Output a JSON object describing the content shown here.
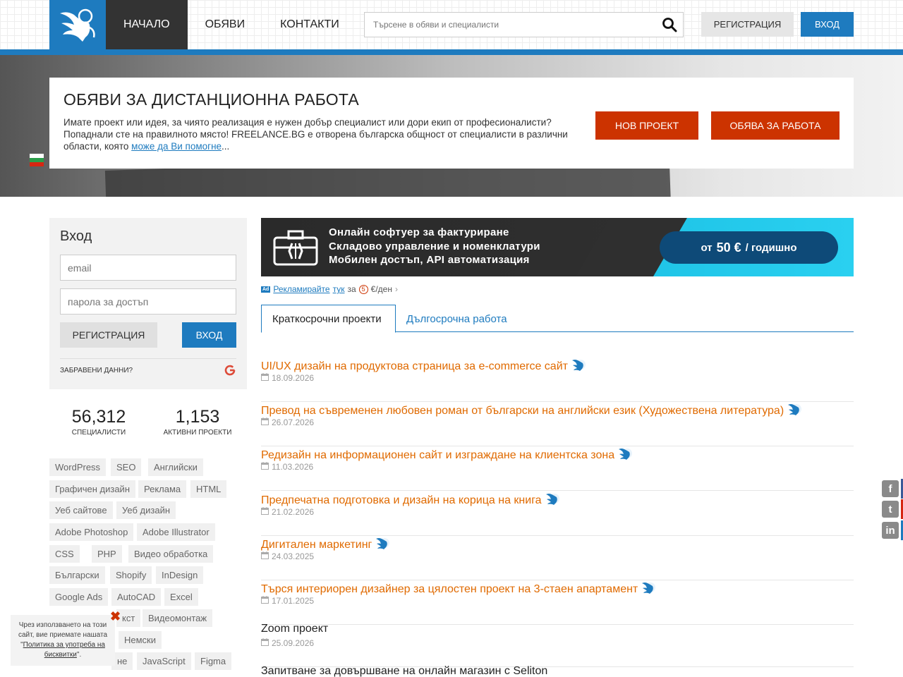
{
  "nav": {
    "items": [
      "Начало",
      "Обяви",
      "Контакти"
    ],
    "search_placeholder": "Търсене в обяви и специалисти",
    "register": "Регистрация",
    "login": "Вход"
  },
  "hero": {
    "title": "Обяви за дистанционна работа",
    "text_1": "Имате проект или идея, за чиято реализация е нужен добър специалист или дори екип от професионалисти? Попаднали сте на правилното място! FREELANCE.BG е отворена българска общност от специалисти в различни области, която ",
    "link": "може да Ви помогне",
    "text_2": "...",
    "btn_new": "Нов проект",
    "btn_job": "Обява за работа"
  },
  "login": {
    "title": "Вход",
    "email_placeholder": "email",
    "password_placeholder": "парола за достъп",
    "register": "Регистрация",
    "login": "Вход",
    "forgot": "Забравени данни?"
  },
  "stats": [
    {
      "num": "56,312",
      "label": "Специалисти"
    },
    {
      "num": "1,153",
      "label": "Активни проекти"
    }
  ],
  "tags": [
    "WordPress",
    "SEO",
    "Английски",
    "Графичен дизайн",
    "Реклама",
    "HTML",
    "Уеб сайтове",
    "Уеб дизайн",
    "Adobe Photoshop",
    "Adobe Illustrator",
    "CSS",
    "PHP",
    "Видео обработка",
    "Български",
    "Shopify",
    "InDesign",
    "Google Ads",
    "AutoCAD",
    "Excel",
    "кст",
    "Видеомонтаж",
    "Немски",
    "не",
    "JavaScript",
    "Figma"
  ],
  "cookie": {
    "text": "Чрез използването на този сайт, вие приемате нашата \"",
    "link": "Политика за употреба на бисквитки",
    "end": "\"."
  },
  "banner": {
    "line1": "Онлайн софтуер за фактуриране",
    "line2": "Складово управление и номенклатури",
    "line3": "Мобилен достъп, API автоматизация",
    "price_pre": "от",
    "price": "50 €",
    "price_post": "/  годишно"
  },
  "ad": {
    "badge": "Ad",
    "link1": "Рекламирайте",
    "link2": "тук",
    "mid": "за",
    "coin": "5",
    "end": "€/ден"
  },
  "tabs": [
    "Краткосрочни проекти",
    "Дългосрочна работа"
  ],
  "projects": [
    {
      "title": "UI/UX дизайн на продуктова страница за e-commerce сайт",
      "date": "18.09.2026",
      "verified": true
    },
    {
      "title": "Превод на съвременен любовен роман от български на английски език (Художествена литература)",
      "date": "26.07.2026",
      "verified": true
    },
    {
      "title": "Редизайн на информационен сайт и изграждане на клиентска зона",
      "date": "11.03.2026",
      "verified": true
    },
    {
      "title": "Предпечатна подготовка и дизайн на корица на книга",
      "date": "21.02.2026",
      "verified": true
    },
    {
      "title": "Дигитален маркетинг",
      "date": "24.03.2025",
      "verified": true
    },
    {
      "title": "Търся интериорен дизайнер за цялостен проект на 3-стаен апартамент",
      "date": "17.01.2025",
      "verified": true
    },
    {
      "title": "Zoom проект",
      "date": "25.09.2026",
      "verified": false
    },
    {
      "title": "Запитване за довършване на онлайн магазин с Seliton",
      "date": "",
      "verified": false
    }
  ],
  "colors": {
    "brand_blue": "#1e7bbf",
    "accent_red": "#cc3300",
    "project_orange": "#e06a00"
  }
}
